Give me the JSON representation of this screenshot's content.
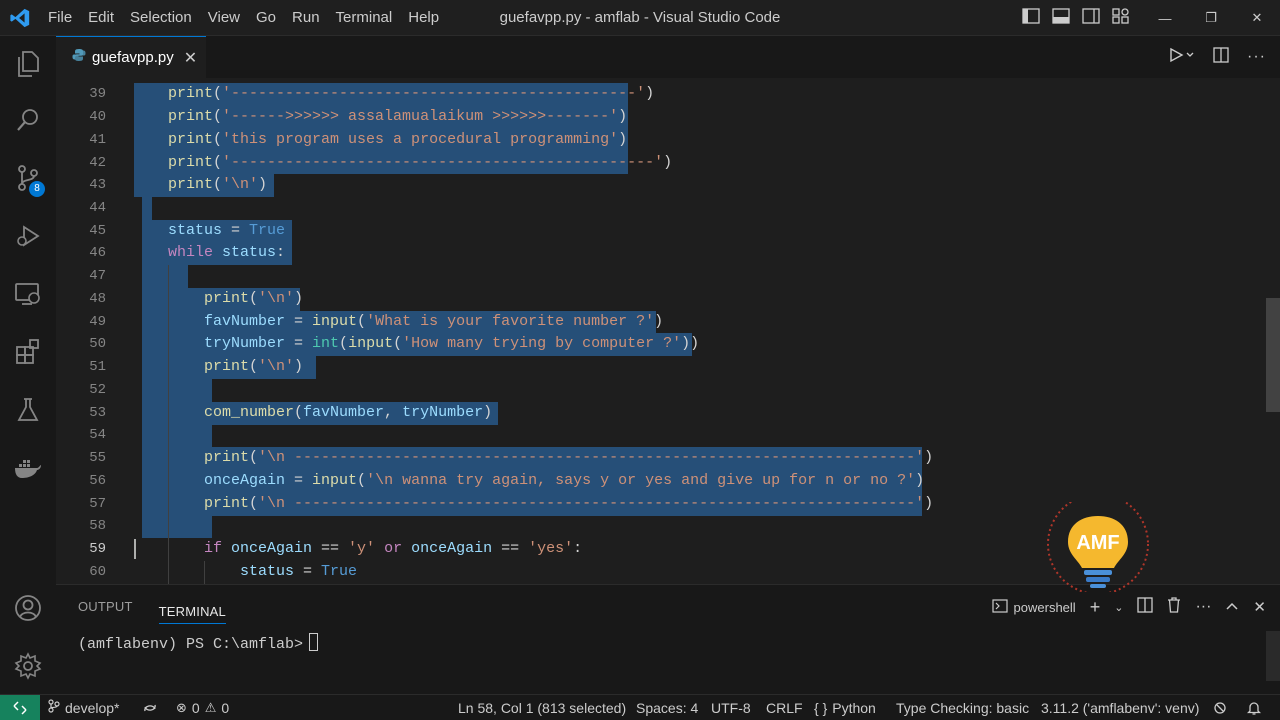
{
  "app": {
    "window_title": "guefavpp.py - amflab - Visual Studio Code",
    "menu": [
      "File",
      "Edit",
      "Selection",
      "View",
      "Go",
      "Run",
      "Terminal",
      "Help"
    ]
  },
  "activity_bar": {
    "items": [
      "explorer-icon",
      "search-icon",
      "source-control-icon",
      "run-debug-icon",
      "remote-explorer-icon",
      "extensions-icon",
      "testing-icon",
      "docker-icon"
    ],
    "source_control_badge": "8",
    "bottom": [
      "accounts-icon",
      "manage-gear-icon"
    ]
  },
  "tabs": [
    {
      "label": "guefavpp.py",
      "active": true,
      "icon": "python-file-icon"
    }
  ],
  "editor": {
    "line_numbers": [
      "39",
      "40",
      "41",
      "42",
      "43",
      "44",
      "45",
      "46",
      "47",
      "48",
      "49",
      "50",
      "51",
      "52",
      "53",
      "54",
      "55",
      "56",
      "57",
      "58",
      "59",
      "60"
    ],
    "current_line": "59",
    "lines": {
      "l39_fn": "print",
      "l39_p1": "(",
      "l39_str": "'---------------------------------------------'",
      "l39_p2": ")",
      "l40_fn": "print",
      "l40_p1": "(",
      "l40_str": "'------>>>>>> assalamualaikum >>>>>>-------'",
      "l40_p2": ")",
      "l41_fn": "print",
      "l41_p1": "(",
      "l41_str": "'this program uses a procedural programming'",
      "l41_p2": ")",
      "l42_fn": "print",
      "l42_p1": "(",
      "l42_str": "'-----------------------------------------------'",
      "l42_p2": ")",
      "l43_fn": "print",
      "l43_p1": "(",
      "l43_str": "'\\n'",
      "l43_p2": ")",
      "l45_var": "status",
      "l45_op": " = ",
      "l45_const": "True",
      "l46_kw": "while",
      "l46_var": " status",
      "l46_op": ":",
      "l48_fn": "print",
      "l48_p1": "(",
      "l48_str": "'\\n'",
      "l48_p2": ")",
      "l49_var": "favNumber",
      "l49_op": " = ",
      "l49_fn": "input",
      "l49_p1": "(",
      "l49_str": "'What is your favorite number ?'",
      "l49_p2": ")",
      "l50_var": "tryNumber",
      "l50_op": " = ",
      "l50_bi": "int",
      "l50_p1": "(",
      "l50_fn": "input",
      "l50_p2": "(",
      "l50_str": "'How many trying by computer ?'",
      "l50_p3": "))",
      "l51_fn": "print",
      "l51_p1": "(",
      "l51_str": "'\\n'",
      "l51_p2": ")",
      "l53_fn": "com_number",
      "l53_p1": "(",
      "l53_var1": "favNumber",
      "l53_op": ", ",
      "l53_var2": "tryNumber",
      "l53_p2": ")",
      "l55_fn": "print",
      "l55_p1": "(",
      "l55_str": "'\\n ---------------------------------------------------------------------'",
      "l55_p2": ")",
      "l56_var": "onceAgain",
      "l56_op": " = ",
      "l56_fn": "input",
      "l56_p1": "(",
      "l56_str": "'\\n wanna try again, says y or yes and give up for n or no ?'",
      "l56_p2": ")",
      "l57_fn": "print",
      "l57_p1": "(",
      "l57_str": "'\\n ---------------------------------------------------------------------'",
      "l57_p2": ")",
      "l59_kw1": "if",
      "l59_var1": " onceAgain",
      "l59_op1": " == ",
      "l59_str1": "'y'",
      "l59_kw2": " or",
      "l59_var2": " onceAgain",
      "l59_op2": " == ",
      "l59_str2": "'yes'",
      "l59_op3": ":",
      "l60_var": "status",
      "l60_op": " = ",
      "l60_const": "True"
    }
  },
  "panel": {
    "tabs": [
      "OUTPUT",
      "TERMINAL"
    ],
    "active_tab": "TERMINAL",
    "terminal_profile": "powershell",
    "terminal_prompt": "(amflabenv) PS C:\\amflab>"
  },
  "status_bar": {
    "branch": "develop*",
    "errors": "0",
    "warnings": "0",
    "cursor_position": "Ln 58, Col 1 (813 selected)",
    "indentation": "Spaces: 4",
    "encoding": "UTF-8",
    "eol": "CRLF",
    "language": "Python",
    "type_checking": "Type Checking: basic",
    "interpreter": "3.11.2 ('amflabenv': venv)"
  },
  "watermark": {
    "text": "AMF"
  },
  "colors": {
    "accent": "#0078d4",
    "remote": "#16825d",
    "selection": "#264f78"
  }
}
